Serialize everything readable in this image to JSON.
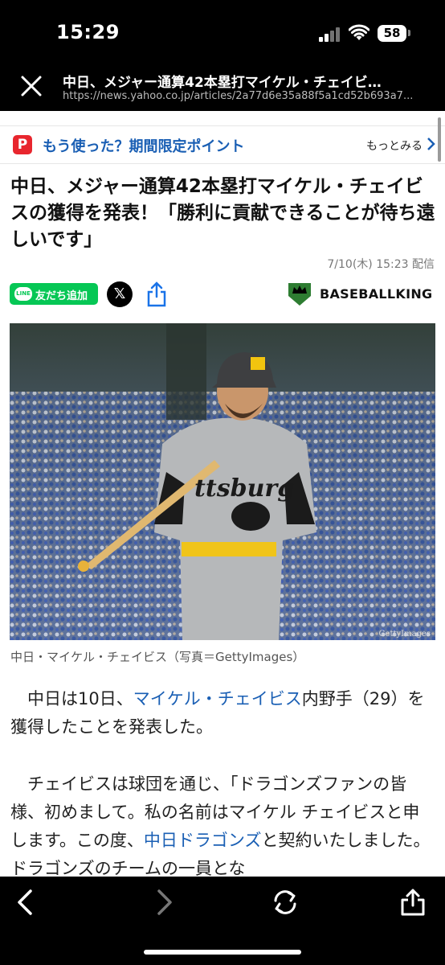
{
  "status": {
    "time": "15:29",
    "battery": "58"
  },
  "browser": {
    "title": "中日、メジャー通算42本塁打マイケル・チェイビ…",
    "url": "https://news.yahoo.co.jp/articles/2a77d6e35a88f5a1cd52b693a7..."
  },
  "promo": {
    "badge": "P",
    "text": "もう使った？期間限定ポイント",
    "more": "もっとみる"
  },
  "article": {
    "headline": "中日、メジャー通算42本塁打マイケル・チェイビスの獲得を発表！「勝利に貢献できることが待ち遠しいです」",
    "date": "7/10(木) 15:23 配信",
    "line_button": "友だち追加",
    "line_icon": "LINE",
    "x_label": "𝕏",
    "source": "BASEBALLKING",
    "photo_credit": "GettyImages",
    "caption": "中日・マイケル・チェイビス（写真＝GettyImages）",
    "p1_pre": "　中日は10日、",
    "p1_link": "マイケル・チェイビス",
    "p1_post": "内野手（29）を獲得したことを発表した。",
    "p2_pre": "　チェイビスは球団を通じ、「ドラゴンズファンの皆様、初めまして。私の名前はマイケル チェイビスと申します。この度、",
    "p2_link": "中日ドラゴンズ",
    "p2_post": "と契約いたしました。ドラゴンズのチームの一員とな"
  },
  "icons": [
    "close-icon",
    "paypay-icon",
    "chevron-right-icon",
    "line-icon",
    "x-icon",
    "share-icon",
    "baseballking-logo-icon",
    "back-icon",
    "forward-icon",
    "reload-icon",
    "share-toolbar-icon"
  ]
}
